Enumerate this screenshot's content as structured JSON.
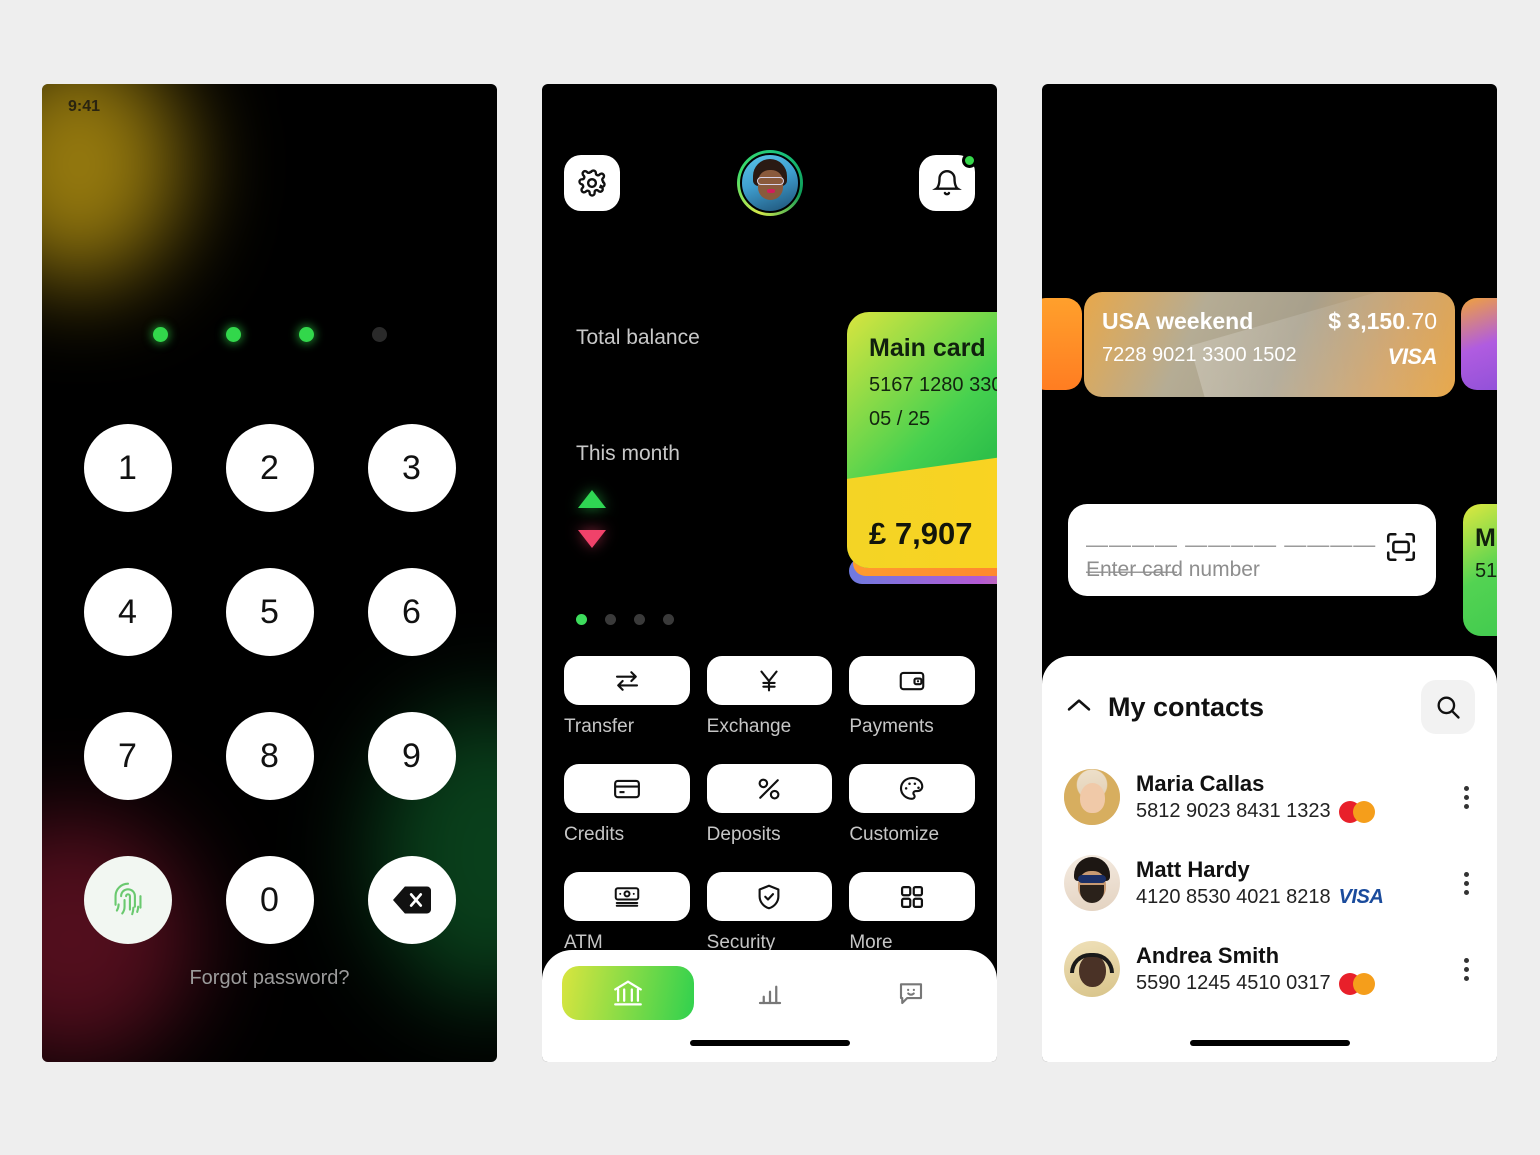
{
  "canvas": {
    "background_color": "#eeeeee"
  },
  "lock_screen": {
    "status_time": "9:41",
    "pin_dots": [
      true,
      true,
      true,
      false
    ],
    "keys": [
      "1",
      "2",
      "3",
      "4",
      "5",
      "6",
      "7",
      "8",
      "9"
    ],
    "fingerprint_key": "fingerprint-icon",
    "zero_key": "0",
    "backspace_key": "backspace-icon",
    "forgot_label": "Forgot password?",
    "accent_color": "#32d74b"
  },
  "home_screen": {
    "settings_icon": "gear-icon",
    "avatar": "user-avatar",
    "notifications_icon": "bell-icon",
    "has_notification": true,
    "total_balance_label": "Total balance",
    "this_month_label": "This month",
    "trend_up": "triangle-up-icon",
    "trend_down": "triangle-down-icon",
    "main_card": {
      "title": "Main card",
      "number": "5167 1280 330",
      "expiry": "05 / 25",
      "amount": "£ 7,907"
    },
    "pager": {
      "count": 4,
      "active_index": 0
    },
    "actions": [
      {
        "label": "Transfer",
        "icon": "transfer-arrows-icon"
      },
      {
        "label": "Exchange",
        "icon": "yen-currency-icon"
      },
      {
        "label": "Payments",
        "icon": "wallet-icon"
      },
      {
        "label": "Credits",
        "icon": "credit-card-icon"
      },
      {
        "label": "Deposits",
        "icon": "percent-icon"
      },
      {
        "label": "Customize",
        "icon": "palette-icon"
      },
      {
        "label": "ATM",
        "icon": "banknote-icon"
      },
      {
        "label": "Security",
        "icon": "shield-check-icon"
      },
      {
        "label": "More",
        "icon": "grid-squares-icon"
      }
    ],
    "nav": [
      {
        "icon": "bank-icon",
        "active": true
      },
      {
        "icon": "bar-chart-icon",
        "active": false
      },
      {
        "icon": "chat-smiley-icon",
        "active": false
      }
    ],
    "accent_gradient": [
      "#d9e53f",
      "#30d14e"
    ]
  },
  "cards_screen": {
    "featured_card": {
      "name": "USA weekend",
      "amount_main": "$ 3,150",
      "amount_decimal": ".70",
      "number": "7228 9021 3300 1502",
      "brand": "VISA"
    },
    "peek_card_right": {
      "title": "M",
      "number": "51"
    },
    "card_input": {
      "mask": "———— ———— ———— ————",
      "placeholder": "Enter card number",
      "scan_icon": "scan-frame-icon"
    },
    "contacts_panel": {
      "collapse_icon": "chevron-up-icon",
      "title": "My contacts",
      "search_icon": "search-icon",
      "rows": [
        {
          "name": "Maria Callas",
          "number": "5812 9023 8431 1323",
          "brand": "mastercard",
          "menu_icon": "kebab-menu-icon"
        },
        {
          "name": "Matt Hardy",
          "number": "4120 8530 4021 8218",
          "brand": "visa",
          "menu_icon": "kebab-menu-icon"
        },
        {
          "name": "Andrea Smith",
          "number": "5590 1245 4510 0317",
          "brand": "mastercard",
          "menu_icon": "kebab-menu-icon"
        }
      ]
    }
  }
}
